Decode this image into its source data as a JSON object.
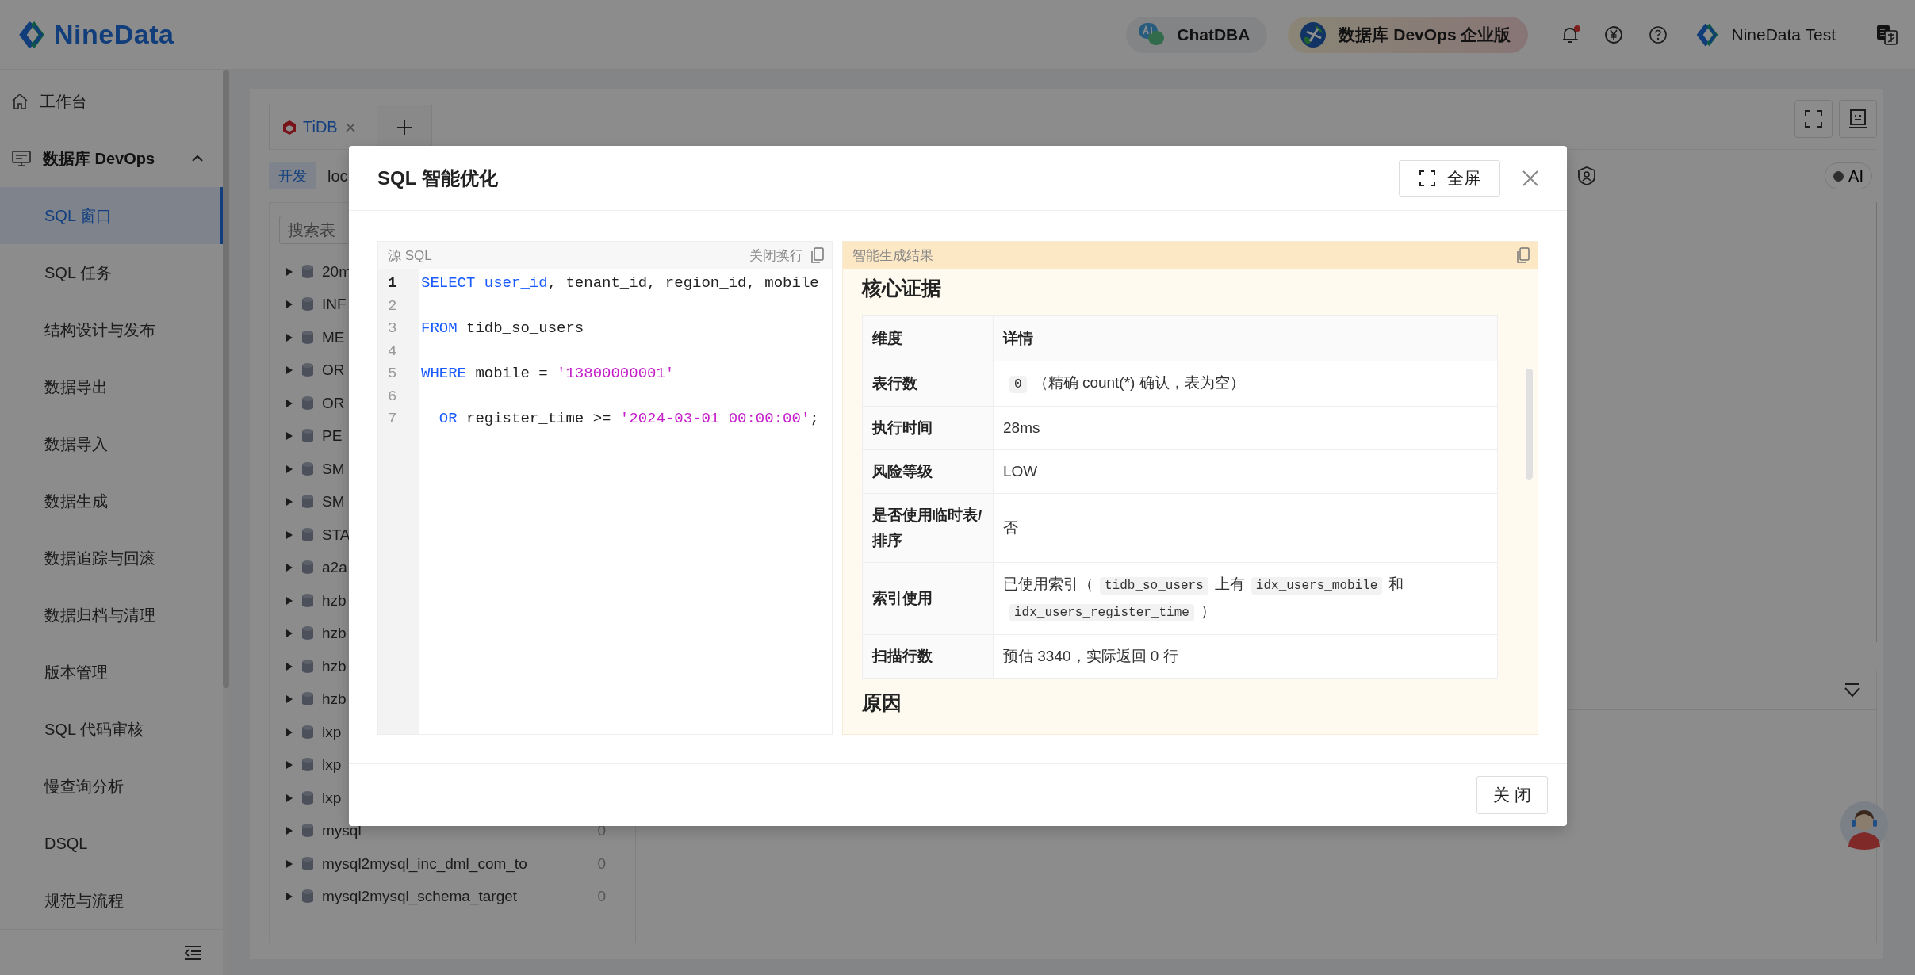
{
  "header": {
    "logo": "NineData",
    "chat": "ChatDBA",
    "edition": "数据库 DevOps 企业版",
    "has_unread": true,
    "user": "NineData Test"
  },
  "sidebar": {
    "items": [
      {
        "kind": "link",
        "label": "工作台",
        "selected": false
      },
      {
        "kind": "group",
        "label": "数据库 DevOps",
        "expanded": true,
        "children": [
          {
            "label": "SQL 窗口",
            "selected": true
          },
          {
            "label": "SQL 任务",
            "selected": false
          },
          {
            "label": "结构设计与发布",
            "selected": false
          },
          {
            "label": "数据导出",
            "selected": false
          },
          {
            "label": "数据导入",
            "selected": false
          },
          {
            "label": "数据生成",
            "selected": false
          },
          {
            "label": "数据追踪与回滚",
            "selected": false
          },
          {
            "label": "数据归档与清理",
            "selected": false
          },
          {
            "label": "版本管理",
            "selected": false
          },
          {
            "label": "SQL 代码审核",
            "selected": false
          },
          {
            "label": "慢查询分析",
            "selected": false
          },
          {
            "label": "DSQL",
            "selected": false
          },
          {
            "label": "规范与流程",
            "selected": false
          }
        ]
      }
    ]
  },
  "workspace": {
    "tabs": [
      {
        "label": "TiDB",
        "selected": true
      }
    ],
    "environment": "开发",
    "connection": "loc",
    "search": {
      "placeholder": "搜索表"
    },
    "ai_toggle": {
      "label": "AI",
      "on": false
    },
    "tree": [
      {
        "name": "20m",
        "expanded": false
      },
      {
        "name": "INF",
        "expanded": false
      },
      {
        "name": "ME",
        "expanded": false
      },
      {
        "name": "OR",
        "expanded": false
      },
      {
        "name": "OR",
        "expanded": false
      },
      {
        "name": "PE",
        "expanded": false
      },
      {
        "name": "SM",
        "expanded": false
      },
      {
        "name": "SM",
        "expanded": false
      },
      {
        "name": "STA",
        "expanded": false
      },
      {
        "name": "a2a",
        "expanded": false
      },
      {
        "name": "hzb",
        "expanded": false
      },
      {
        "name": "hzb",
        "expanded": false
      },
      {
        "name": "hzb",
        "expanded": false
      },
      {
        "name": "hzb",
        "expanded": false
      },
      {
        "name": "lxp",
        "expanded": false
      },
      {
        "name": "lxp",
        "expanded": false
      },
      {
        "name": "lxp",
        "expanded": false
      },
      {
        "name": "mysql",
        "count": "0",
        "expanded": false
      },
      {
        "name": "mysql2mysql_inc_dml_com_to",
        "count": "0",
        "expanded": false
      },
      {
        "name": "mysql2mysql_schema_target",
        "count": "0",
        "expanded": false
      }
    ]
  },
  "modal": {
    "title": "SQL 智能优化",
    "fullscreen": "全屏",
    "source": {
      "title": "源 SQL",
      "wrap_toggle": "关闭换行",
      "lines": [
        {
          "number": "1",
          "current": true,
          "tokens": [
            {
              "kind": "keyword",
              "text": "SELECT user_id"
            },
            {
              "kind": "plain",
              "text": ", tenant_id, region_id, mobile"
            }
          ]
        },
        {
          "number": "2",
          "current": false
        },
        {
          "number": "3",
          "current": false,
          "tokens": [
            {
              "kind": "keyword",
              "text": "FROM"
            },
            {
              "kind": "plain",
              "text": " tidb_so_users"
            }
          ]
        },
        {
          "number": "4",
          "current": false
        },
        {
          "number": "5",
          "current": false,
          "tokens": [
            {
              "kind": "keyword",
              "text": "WHERE"
            },
            {
              "kind": "plain",
              "text": " mobile = "
            },
            {
              "kind": "string",
              "text": "'13800000001'"
            }
          ]
        },
        {
          "number": "6",
          "current": false
        },
        {
          "number": "7",
          "current": false,
          "tokens": [
            {
              "kind": "keyword",
              "text": "  OR"
            },
            {
              "kind": "plain",
              "text": " register_time >= "
            },
            {
              "kind": "string",
              "text": "'2024-03-01 00:00:00'"
            },
            {
              "kind": "plain",
              "text": ";"
            }
          ]
        }
      ]
    },
    "result": {
      "title": "智能生成结果",
      "sections": [
        {
          "heading": "核心证据",
          "table": {
            "columns": [
              "维度",
              "详情"
            ],
            "rows": [
              {
                "label": "表行数",
                "detail": [
                  {
                    "kind": "code",
                    "text": "0"
                  },
                  {
                    "kind": "text",
                    "text": "（精确 count(*) 确认，表为空）"
                  }
                ]
              },
              {
                "label": "执行时间",
                "detail": [
                  {
                    "kind": "text",
                    "text": "28ms"
                  }
                ]
              },
              {
                "label": "风险等级",
                "detail": [
                  {
                    "kind": "text",
                    "text": "LOW"
                  }
                ]
              },
              {
                "label": "是否使用临时表/排序",
                "detail": [
                  {
                    "kind": "text",
                    "text": "否"
                  }
                ]
              },
              {
                "label": "索引使用",
                "detail": [
                  {
                    "kind": "text",
                    "text": "已使用索引（"
                  },
                  {
                    "kind": "code",
                    "text": "tidb_so_users"
                  },
                  {
                    "kind": "text",
                    "text": "上有"
                  },
                  {
                    "kind": "code",
                    "text": "idx_users_mobile"
                  },
                  {
                    "kind": "text",
                    "text": "和"
                  },
                  {
                    "kind": "code",
                    "text": "idx_users_register_time"
                  },
                  {
                    "kind": "text",
                    "text": "）"
                  }
                ]
              },
              {
                "label": "扫描行数",
                "detail": [
                  {
                    "kind": "text",
                    "text": "预估 3340，实际返回 0 行"
                  }
                ]
              }
            ]
          }
        },
        {
          "heading": "原因"
        }
      ]
    },
    "close": "关 闭"
  }
}
